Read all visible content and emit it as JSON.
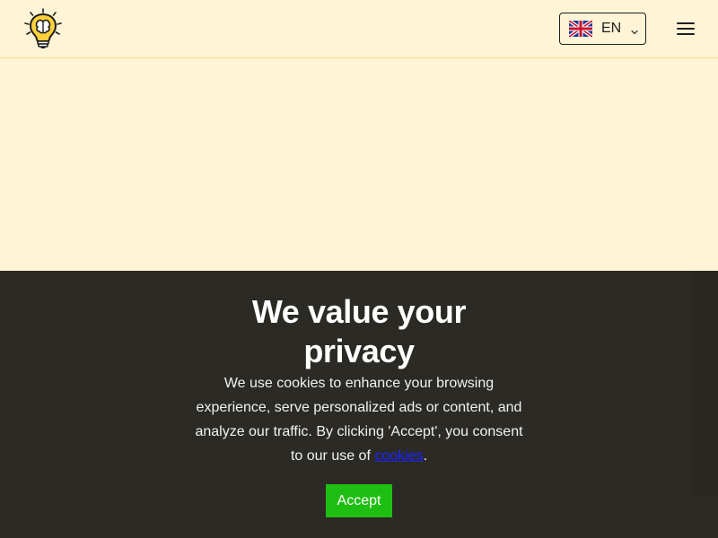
{
  "header": {
    "language": {
      "code": "EN",
      "icon": "uk-flag-icon"
    },
    "menu_icon": "hamburger-menu-icon",
    "logo_icon": "lightbulb-brain-logo"
  },
  "cookie_banner": {
    "title": "We value your privacy",
    "text_before_link": "We use cookies to enhance your browsing experience, serve personalized ads or content, and analyze our traffic. By clicking 'Accept', you consent to our use of ",
    "link_text": "cookies",
    "text_after_link": ".",
    "accept_label": "Accept",
    "accept_color": "#1fbe12"
  }
}
